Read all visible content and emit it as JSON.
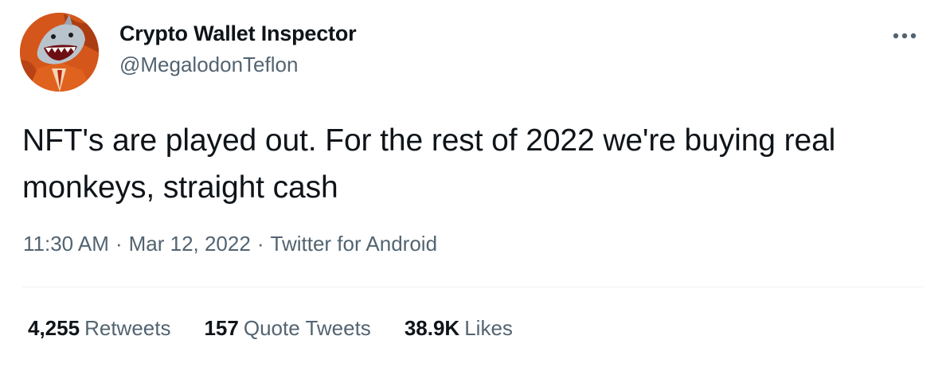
{
  "author": {
    "display_name": "Crypto Wallet Inspector",
    "handle": "@MegalodonTeflon",
    "avatar_icon": "shark-avatar-icon"
  },
  "more_icon": "more-dots-icon",
  "tweet": {
    "text": "NFT's are played out. For the rest of 2022 we're buying real monkeys, straight cash",
    "time": "11:30 AM",
    "date": "Mar 12, 2022",
    "separator": "·",
    "source": "Twitter for Android"
  },
  "stats": {
    "retweets_count": "4,255",
    "retweets_label": "Retweets",
    "quotes_count": "157",
    "quotes_label": "Quote Tweets",
    "likes_count": "38.9K",
    "likes_label": "Likes"
  },
  "colors": {
    "text_primary": "#0f1419",
    "text_secondary": "#536471",
    "divider": "#eff3f4",
    "avatar_orange": "#d4561a"
  }
}
